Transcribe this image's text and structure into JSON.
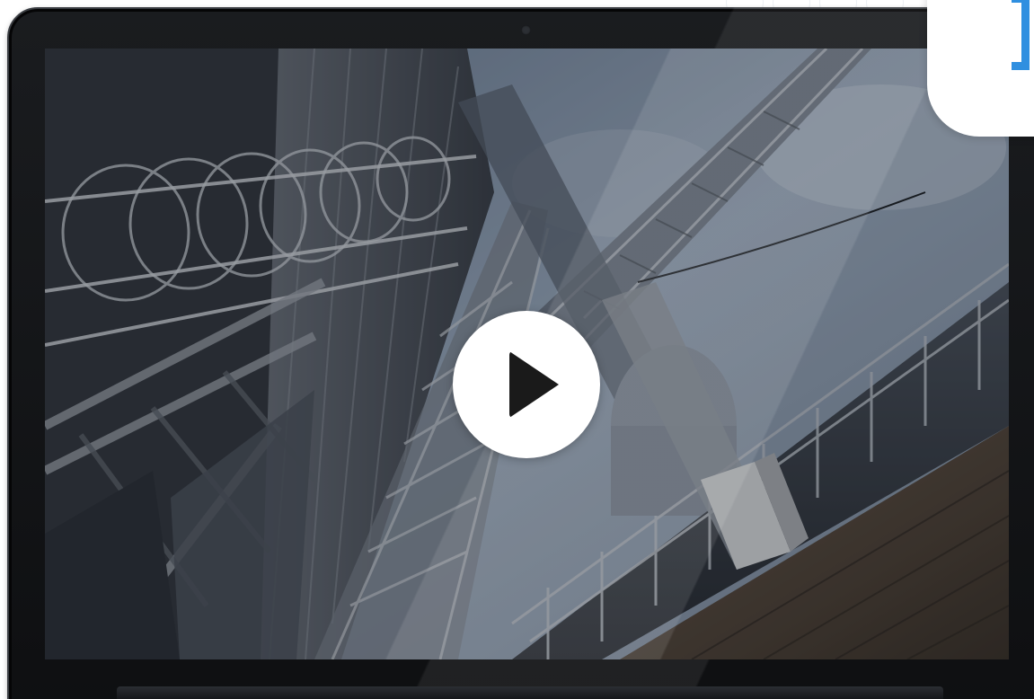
{
  "video": {
    "state": "paused"
  },
  "icons": {
    "play": "play-icon",
    "card": "bracket-icon"
  },
  "colors": {
    "accent": "#2f8fe0",
    "bezel": "#111214",
    "play_button": "#ffffff"
  }
}
